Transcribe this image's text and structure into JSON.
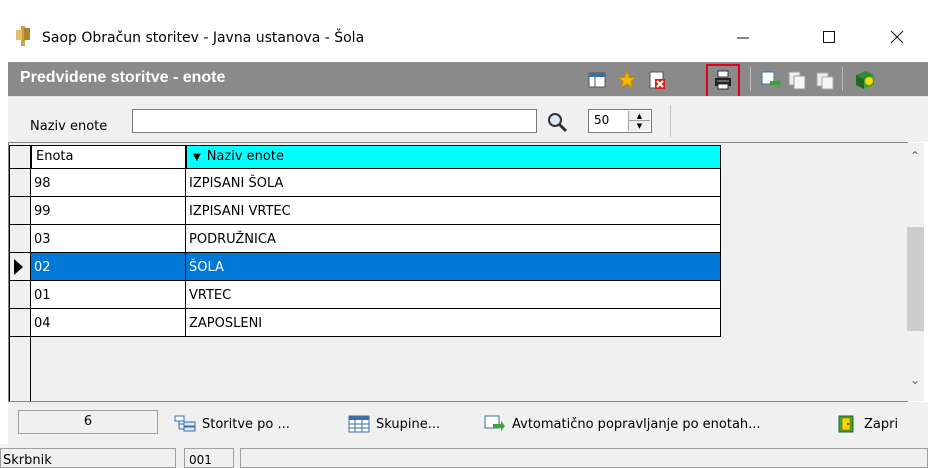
{
  "window": {
    "title": "Saop Obračun storitev - Javna ustanova - Šola"
  },
  "banner": {
    "title": "Predvidene storitve - enote"
  },
  "search": {
    "label": "Naziv enote",
    "value": "",
    "limit": "50"
  },
  "grid": {
    "columns": [
      "Enota",
      "Naziv enote"
    ],
    "rows": [
      {
        "enota": "98",
        "naziv": "IZPISANI ŠOLA",
        "selected": false
      },
      {
        "enota": "99",
        "naziv": "IZPISANI VRTEC",
        "selected": false
      },
      {
        "enota": "03",
        "naziv": "PODRUŽNICA",
        "selected": false
      },
      {
        "enota": "02",
        "naziv": "ŠOLA",
        "selected": true
      },
      {
        "enota": "01",
        "naziv": "VRTEC",
        "selected": false
      },
      {
        "enota": "04",
        "naziv": "ZAPOSLENI",
        "selected": false
      }
    ]
  },
  "bottom": {
    "count": "6",
    "storitve_label": "Storitve po ...",
    "skupine_label": "Skupine...",
    "avtomaticno_label": "Avtomatično popravljanje po enotah...",
    "zapri_label": "Zapri"
  },
  "status": {
    "user": "Skrbnik",
    "code": "001"
  },
  "colors": {
    "banner": "#8a8a8a",
    "header_active": "#00ffff",
    "selection": "#0078d7",
    "highlight": "#e4001b"
  }
}
